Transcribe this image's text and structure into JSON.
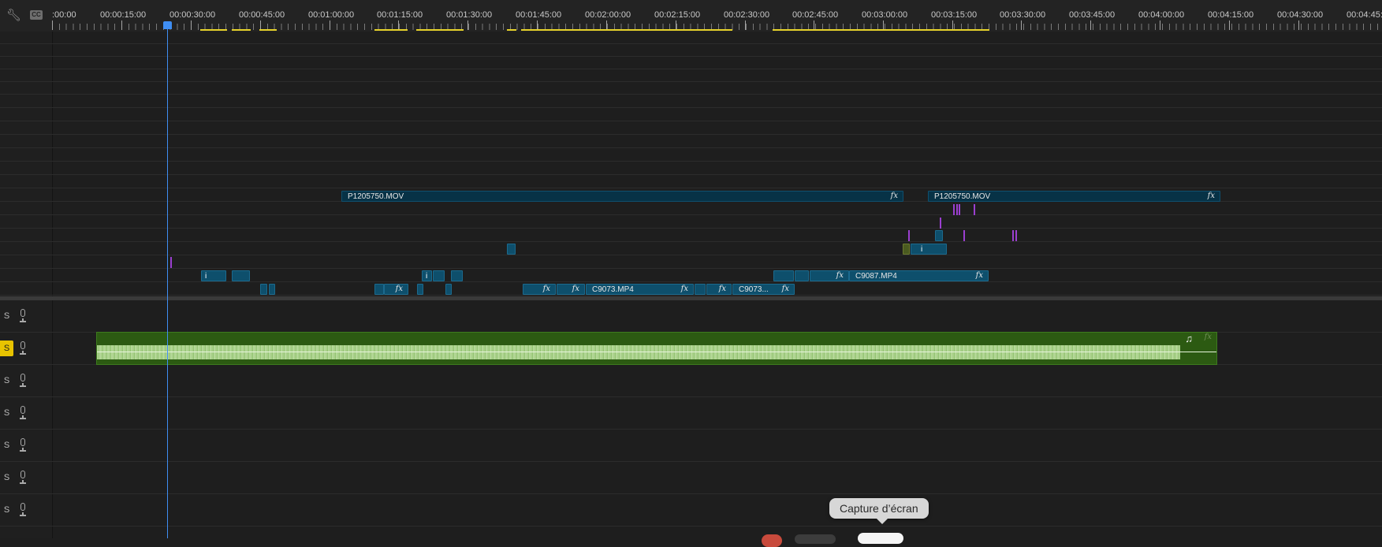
{
  "timeline": {
    "timecodes": [
      ":00:00",
      "00:00:15:00",
      "00:00:30:00",
      "00:00:45:00",
      "00:01:00:00",
      "00:01:15:00",
      "00:01:30:00",
      "00:01:45:00",
      "00:02:00:00",
      "00:02:15:00",
      "00:02:30:00",
      "00:02:45:00",
      "00:03:00:00",
      "00:03:15:00",
      "00:03:30:00",
      "00:03:45:00",
      "00:04:00:00",
      "00:04:15:00",
      "00:04:30:00",
      "00:04:45:"
    ],
    "playhead": "00:00:30:00"
  },
  "toolbar": {
    "wrench_icon": "wrench-icon",
    "cc_icon": "captions-icon",
    "cc_text": "CC"
  },
  "clips": {
    "p1_name": "P1205750.MOV",
    "p2_name": "P1205750.MOV",
    "c9073_name": "C9073.MP4",
    "c9073b_name": "C9073...",
    "c9087_name": "C9087.MP4",
    "fx": "fx",
    "info": "i"
  },
  "audio_tracks": {
    "solo_label": "S",
    "music_icon": "♫",
    "fx": "fx"
  },
  "tooltip": {
    "text": "Capture d’écran"
  },
  "colors": {
    "playhead": "#3f8ef3",
    "solo_active": "#e8c300",
    "video_clip": "#0e4f6c",
    "audio_clip": "#2c5a12",
    "in_out_bar": "#e6d22a"
  }
}
